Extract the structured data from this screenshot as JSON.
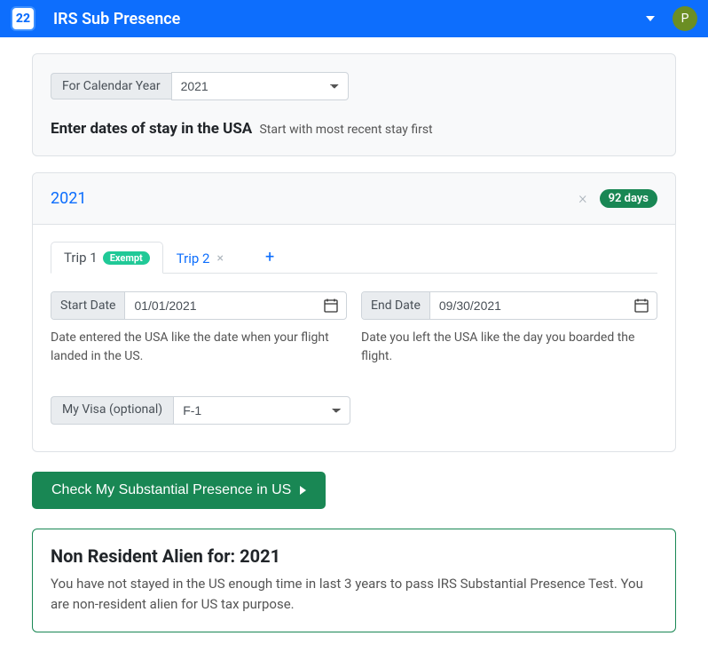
{
  "header": {
    "logo_text": "22",
    "title": "IRS Sub Presence",
    "avatar_letter": "P"
  },
  "calendar_section": {
    "label": "For Calendar Year",
    "selected_year": "2021",
    "heading": "Enter dates of stay in the USA",
    "subheading": "Start with most recent stay first"
  },
  "year_panel": {
    "year": "2021",
    "days_badge": "92 days",
    "tabs": {
      "trip1": {
        "label": "Trip 1",
        "badge": "Exempt"
      },
      "trip2": {
        "label": "Trip 2"
      },
      "add": "+"
    },
    "start": {
      "label": "Start Date",
      "value": "01/01/2021",
      "hint": "Date entered the USA like the date when your flight landed in the US."
    },
    "end": {
      "label": "End Date",
      "value": "09/30/2021",
      "hint": "Date you left the USA like the day you boarded the flight."
    },
    "visa": {
      "label": "My Visa (optional)",
      "selected": "F-1"
    }
  },
  "check_button": "Check My Substantial Presence in US",
  "result": {
    "title": "Non Resident Alien for: 2021",
    "body": "You have not stayed in the US enough time in last 3 years to pass IRS Substantial Presence Test. You are non-resident alien for US tax purpose."
  }
}
